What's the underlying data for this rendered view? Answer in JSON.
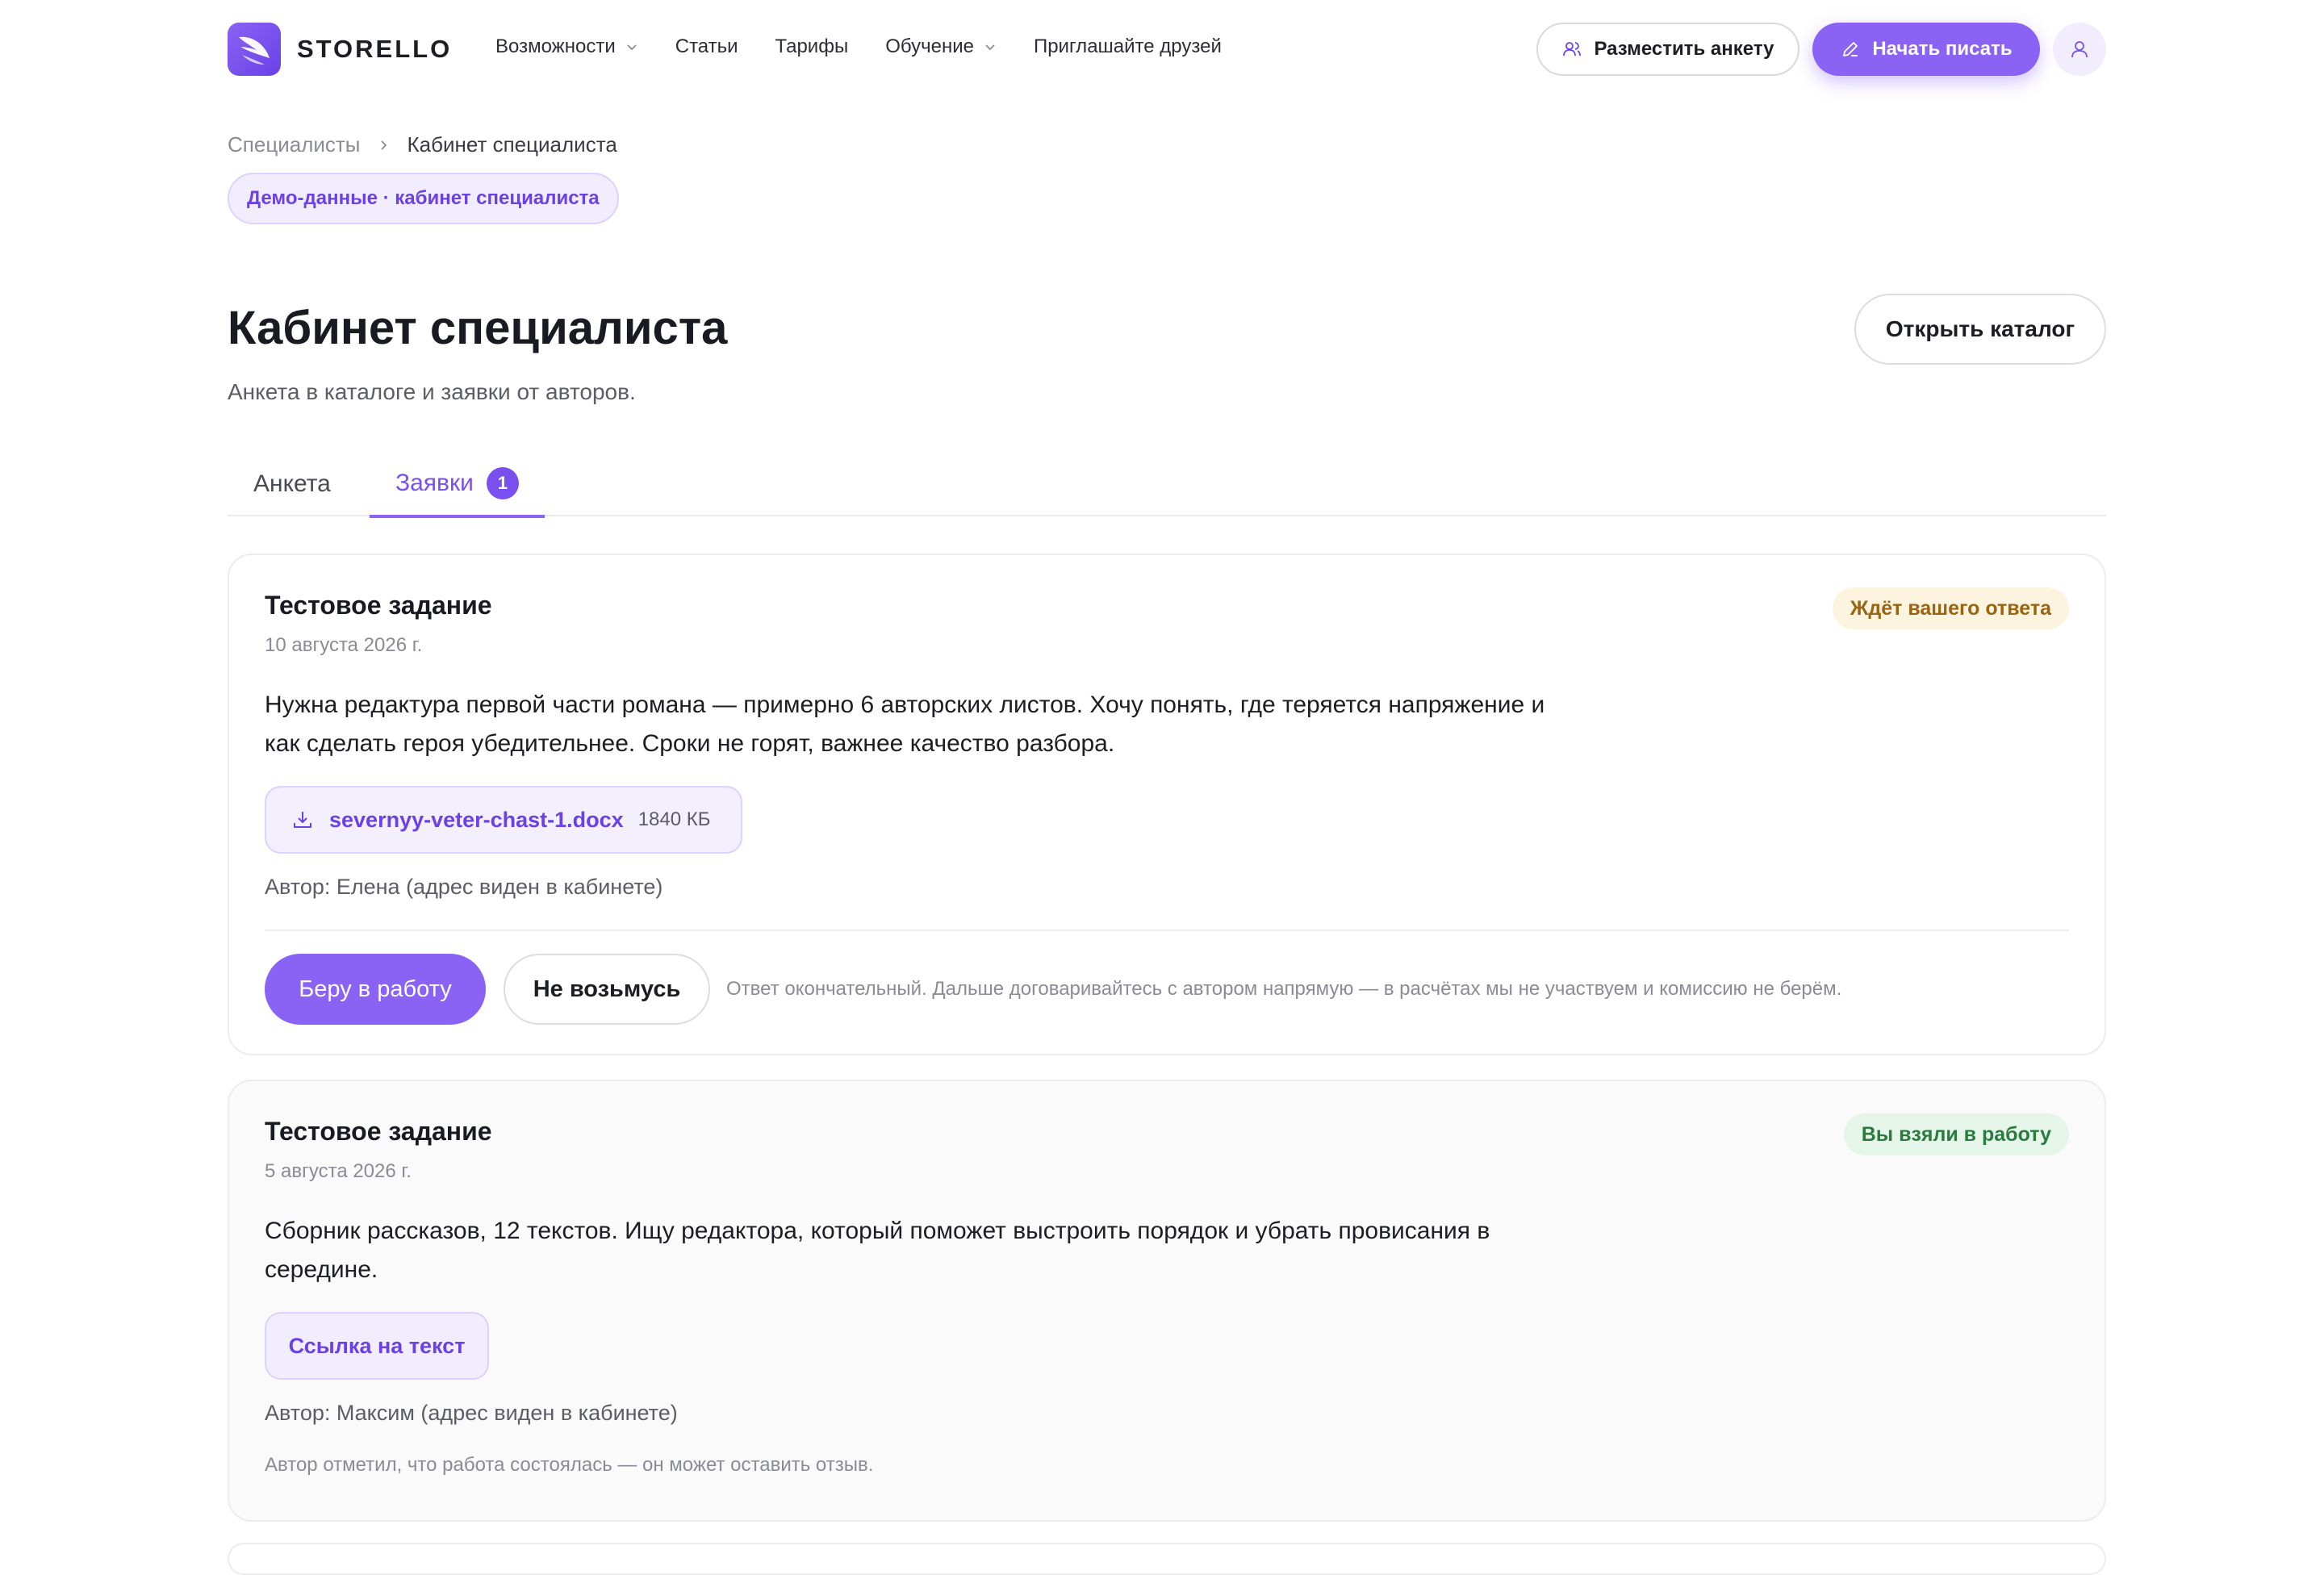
{
  "header": {
    "brand": "STORELLO",
    "nav": [
      {
        "label": "Возможности",
        "dropdown": true
      },
      {
        "label": "Статьи",
        "dropdown": false
      },
      {
        "label": "Тарифы",
        "dropdown": false
      },
      {
        "label": "Обучение",
        "dropdown": true
      },
      {
        "label": "Приглашайте друзей",
        "dropdown": false
      }
    ],
    "post_profile_label": "Разместить анкету",
    "start_writing_label": "Начать писать",
    "accent_color": "#8a63f5"
  },
  "breadcrumb": {
    "parent": "Специалисты",
    "current": "Кабинет специалиста"
  },
  "demo_badge": "Демо-данные · кабинет специалиста",
  "page": {
    "title": "Кабинет специалиста",
    "subtitle": "Анкета в каталоге и заявки от авторов.",
    "catalog_button": "Открыть каталог"
  },
  "tabs": [
    {
      "label": "Анкета",
      "active": false
    },
    {
      "label": "Заявки",
      "active": true,
      "count": "1"
    }
  ],
  "requests": [
    {
      "title": "Тестовое задание",
      "date": "10 августа 2026 г.",
      "status": "Ждёт вашего ответа",
      "status_color": "#9a6512",
      "text": "Нужна редактура первой части романа — примерно 6 авторских листов. Хочу понять, где теряется напряжение и как сделать героя убедительнее. Сроки не горят, важнее качество разбора.",
      "file_name": "severnyy-veter-chast-1.docx",
      "file_size": "1840 КБ",
      "author": "Автор: Елена (адрес виден в кабинете)",
      "accept_label": "Беру в работу",
      "decline_label": "Не возьмусь",
      "note": "Ответ окончательный. Дальше договаривайтесь с автором напрямую — в расчётах мы не участвуем и комиссию не берём."
    },
    {
      "title": "Тестовое задание",
      "date": "5 августа 2026 г.",
      "status": "Вы взяли в работу",
      "status_color": "#2b7b3e",
      "text": "Сборник рассказов, 12 текстов. Ищу редактора, который поможет выстроить порядок и убрать провисания в середине.",
      "link_label": "Ссылка на текст",
      "author": "Автор: Максим (адрес виден в кабинете)",
      "footnote": "Автор отметил, что работа состоялась — он может оставить отзыв."
    }
  ]
}
